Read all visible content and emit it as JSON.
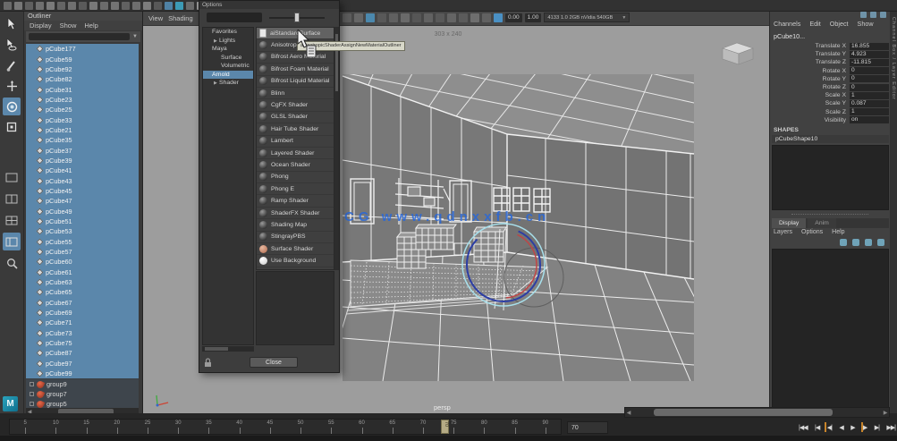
{
  "shelf": {
    "icons": [
      {
        "name": "shelf-icon",
        "color": "#6a6a6a"
      },
      {
        "name": "shelf-icon",
        "color": "#777777"
      },
      {
        "name": "shelf-icon",
        "color": "#5f5f5f"
      },
      {
        "name": "shelf-icon",
        "color": "#6f6f6f"
      },
      {
        "name": "shelf-icon",
        "color": "#7a7a7a"
      },
      {
        "name": "shelf-icon",
        "color": "#646464"
      },
      {
        "name": "shelf-icon",
        "color": "#707070"
      },
      {
        "name": "shelf-icon",
        "color": "#5a5a5a"
      },
      {
        "name": "shelf-icon",
        "color": "#787878"
      },
      {
        "name": "shelf-icon",
        "color": "#6b6b6b"
      },
      {
        "name": "shelf-icon",
        "color": "#737373"
      },
      {
        "name": "shelf-icon",
        "color": "#616161"
      },
      {
        "name": "shelf-icon",
        "color": "#6e6e6e"
      },
      {
        "name": "shelf-icon",
        "color": "#7c7c7c"
      },
      {
        "name": "shelf-icon",
        "color": "#585858"
      },
      {
        "name": "shelf-icon",
        "color": "#4f81a4"
      },
      {
        "name": "shelf-icon",
        "color": "#3c9ab5"
      },
      {
        "name": "shelf-icon",
        "color": "#6a6a6a"
      },
      {
        "name": "shelf-icon",
        "color": "#9a9a9a"
      },
      {
        "name": "shelf-icon",
        "color": "#8d8d8d"
      },
      {
        "name": "shelf-icon",
        "color": "#969696"
      },
      {
        "name": "shelf-icon",
        "color": "#6d6d6d"
      },
      {
        "name": "shelf-icon",
        "color": "#5e5e5e"
      },
      {
        "name": "shelf-icon",
        "color": "#757575"
      },
      {
        "name": "shelf-icon",
        "color": "#686868"
      },
      {
        "name": "shelf-icon",
        "color": "#7b7b7b"
      },
      {
        "name": "shelf-icon",
        "color": "#5c5c5c"
      },
      {
        "name": "shelf-icon",
        "color": "#4a7ea6"
      },
      {
        "name": "shelf-icon",
        "color": "#717171"
      },
      {
        "name": "shelf-icon",
        "color": "#666666"
      }
    ]
  },
  "toolbox": {
    "tools": [
      {
        "name": "select-tool",
        "glyph": "arrow",
        "active": false
      },
      {
        "name": "lasso-tool",
        "glyph": "lasso",
        "active": false
      },
      {
        "name": "paint-select-tool",
        "glyph": "brush",
        "active": false
      },
      {
        "name": "move-tool",
        "glyph": "move",
        "active": false
      },
      {
        "name": "rotate-tool",
        "glyph": "rotate",
        "active": true
      },
      {
        "name": "scale-tool",
        "glyph": "scale",
        "active": false
      }
    ],
    "layouts": [
      {
        "name": "single-pane-layout",
        "glyph": "pane1",
        "active": false
      },
      {
        "name": "two-pane-layout",
        "glyph": "pane2",
        "active": false
      },
      {
        "name": "four-pane-layout",
        "glyph": "pane4",
        "active": false
      },
      {
        "name": "persp-outliner-layout",
        "glyph": "paneo",
        "active": true
      },
      {
        "name": "zoom-layout",
        "glyph": "zoom",
        "active": false
      }
    ],
    "logo": "M"
  },
  "outliner": {
    "title": "Outliner",
    "menus": [
      {
        "label": "Display"
      },
      {
        "label": "Show"
      },
      {
        "label": "Help"
      }
    ],
    "items": [
      {
        "name": "pCube177",
        "selected": true
      },
      {
        "name": "pCube59",
        "selected": true
      },
      {
        "name": "pCube92",
        "selected": true
      },
      {
        "name": "pCube82",
        "selected": true
      },
      {
        "name": "pCube31",
        "selected": true
      },
      {
        "name": "pCube23",
        "selected": true
      },
      {
        "name": "pCube25",
        "selected": true
      },
      {
        "name": "pCube33",
        "selected": true
      },
      {
        "name": "pCube21",
        "selected": true
      },
      {
        "name": "pCube35",
        "selected": true
      },
      {
        "name": "pCube37",
        "selected": true
      },
      {
        "name": "pCube39",
        "selected": true
      },
      {
        "name": "pCube41",
        "selected": true
      },
      {
        "name": "pCube43",
        "selected": true
      },
      {
        "name": "pCube45",
        "selected": true
      },
      {
        "name": "pCube47",
        "selected": true
      },
      {
        "name": "pCube49",
        "selected": true
      },
      {
        "name": "pCube51",
        "selected": true
      },
      {
        "name": "pCube53",
        "selected": true
      },
      {
        "name": "pCube55",
        "selected": true
      },
      {
        "name": "pCube57",
        "selected": true
      },
      {
        "name": "pCube60",
        "selected": true
      },
      {
        "name": "pCube61",
        "selected": true
      },
      {
        "name": "pCube63",
        "selected": true
      },
      {
        "name": "pCube65",
        "selected": true
      },
      {
        "name": "pCube67",
        "selected": true
      },
      {
        "name": "pCube69",
        "selected": true
      },
      {
        "name": "pCube71",
        "selected": true
      },
      {
        "name": "pCube73",
        "selected": true
      },
      {
        "name": "pCube75",
        "selected": true
      },
      {
        "name": "pCube87",
        "selected": true
      },
      {
        "name": "pCube97",
        "selected": true
      },
      {
        "name": "pCube99",
        "selected": true
      }
    ],
    "groups": [
      {
        "name": "group9"
      },
      {
        "name": "group7"
      },
      {
        "name": "group5"
      }
    ]
  },
  "panelbar": {
    "menus": [
      {
        "label": "View"
      },
      {
        "label": "Shading"
      }
    ],
    "exposure": "0.00",
    "gamma": "1.00",
    "renderer_label": "4133 1.0 2GB nVidia 540GB",
    "icons": [
      {
        "name": "select-camera-icon",
        "color": "#5d5d5d"
      },
      {
        "name": "lock-camera-icon",
        "color": "#666666"
      },
      {
        "name": "camera-attributes-icon",
        "color": "#4b88ad"
      },
      {
        "name": "bookmark-icon",
        "color": "#585858"
      },
      {
        "name": "image-plane-icon",
        "color": "#606060"
      },
      {
        "name": "view-grid-icon",
        "color": "#6a6a6a"
      },
      {
        "name": "film-gate-icon",
        "color": "#565656"
      },
      {
        "name": "resolution-gate-icon",
        "color": "#626262"
      },
      {
        "name": "gate-mask-icon",
        "color": "#595959"
      },
      {
        "name": "field-chart-icon",
        "color": "#646464"
      },
      {
        "name": "safe-action-icon",
        "color": "#5b5b5b"
      },
      {
        "name": "exposure-icon",
        "color": "#6e6e6e"
      },
      {
        "name": "gamma-icon",
        "color": "#616161"
      },
      {
        "name": "vr-icon",
        "color": "#4a90c4"
      }
    ]
  },
  "viewport": {
    "resolution_label": "303 x 240",
    "camera_label": "persp",
    "watermark": "技艺CG  www.qdnxxfb.cn",
    "watermark_color": "#2a68d8"
  },
  "dialog": {
    "title": "Options",
    "tree": [
      {
        "label": "Favorites",
        "pad": "4px",
        "bullet": true,
        "arrow": "",
        "selected": false
      },
      {
        "label": "Lights",
        "pad": "12px",
        "bullet": false,
        "arrow": "▶",
        "selected": false
      },
      {
        "label": "Maya",
        "pad": "4px",
        "bullet": true,
        "arrow": "",
        "selected": false
      },
      {
        "label": "Surface",
        "pad": "14px",
        "bullet": false,
        "arrow": "",
        "selected": false
      },
      {
        "label": "Volumetric",
        "pad": "14px",
        "bullet": false,
        "arrow": "",
        "selected": false
      },
      {
        "label": "Arnold",
        "pad": "4px",
        "bullet": true,
        "arrow": "",
        "selected": true
      },
      {
        "label": "Shader",
        "pad": "12px",
        "bullet": false,
        "arrow": "▶",
        "selected": false
      }
    ],
    "materials": [
      {
        "label": "aiStandardSurface",
        "isfile": true,
        "selected": true
      },
      {
        "label": "Anisotropic"
      },
      {
        "label": "Bifrost Aero Material"
      },
      {
        "label": "Bifrost Foam Material"
      },
      {
        "label": "Bifrost Liquid Material"
      },
      {
        "label": "Blinn"
      },
      {
        "label": "CgFX Shader"
      },
      {
        "label": "GLSL Shader"
      },
      {
        "label": "Hair Tube Shader"
      },
      {
        "label": "Lambert"
      },
      {
        "label": "Layered Shader"
      },
      {
        "label": "Ocean Shader"
      },
      {
        "label": "Phong"
      },
      {
        "label": "Phong E"
      },
      {
        "label": "Ramp Shader"
      },
      {
        "label": "ShaderFX Shader"
      },
      {
        "label": "Shading Map"
      },
      {
        "label": "StingrayPBS"
      },
      {
        "label": "Surface Shader",
        "swatch": "radial-gradient(circle at 35% 30%, #e8b9a0, #b06a4e)"
      },
      {
        "label": "Use Background",
        "swatch": "radial-gradient(circle at 35% 30%, #ffffff, #c9c9c9)"
      }
    ],
    "tooltip": "anisotropicShaderAssignNewMaterialOutliner",
    "close_label": "Close"
  },
  "channel_box": {
    "menus": [
      {
        "label": "Channels"
      },
      {
        "label": "Edit"
      },
      {
        "label": "Object"
      },
      {
        "label": "Show"
      }
    ],
    "node_name": "pCube10...",
    "attributes": [
      {
        "label": "Translate X",
        "value": "16.855"
      },
      {
        "label": "Translate Y",
        "value": "4.923"
      },
      {
        "label": "Translate Z",
        "value": "-11.815"
      },
      {
        "label": "Rotate X",
        "value": "0"
      },
      {
        "label": "Rotate Y",
        "value": "0"
      },
      {
        "label": "Rotate Z",
        "value": "0"
      },
      {
        "label": "Scale X",
        "value": "1"
      },
      {
        "label": "Scale Y",
        "value": "0.087"
      },
      {
        "label": "Scale Z",
        "value": "1"
      },
      {
        "label": "Visibility",
        "value": "on"
      }
    ],
    "shapes_label": "SHAPES",
    "shape_name": "pCubeShape10",
    "sidebar_tab": "Channel Box / Layer Editor"
  },
  "layer_editor": {
    "tabs": [
      {
        "label": "Display",
        "active": true
      },
      {
        "label": "Anim",
        "active": false
      }
    ],
    "menus": [
      {
        "label": "Layers"
      },
      {
        "label": "Options"
      },
      {
        "label": "Help"
      }
    ],
    "icons": [
      {
        "name": "new-empty-layer-icon"
      },
      {
        "name": "new-layer-selected-icon"
      },
      {
        "name": "new-render-layer-icon"
      },
      {
        "name": "layer-options-icon"
      }
    ]
  },
  "timeline": {
    "ticks": [
      {
        "label": "5"
      },
      {
        "label": "10"
      },
      {
        "label": "15"
      },
      {
        "label": "20"
      },
      {
        "label": "25"
      },
      {
        "label": "30"
      },
      {
        "label": "35"
      },
      {
        "label": "40"
      },
      {
        "label": "45"
      },
      {
        "label": "50"
      },
      {
        "label": "55"
      },
      {
        "label": "60"
      },
      {
        "label": "65"
      },
      {
        "label": "70"
      },
      {
        "label": "75"
      },
      {
        "label": "80"
      },
      {
        "label": "85"
      },
      {
        "label": "90"
      }
    ],
    "current_frame": "70",
    "current_time_field": "70",
    "playback": [
      {
        "glyph": "|◀◀",
        "name": "go-to-start-button"
      },
      {
        "glyph": "|◀",
        "name": "step-back-frame-button"
      },
      {
        "glyph": "◀|",
        "name": "step-back-key-button"
      },
      {
        "glyph": "◀",
        "name": "play-backwards-button"
      },
      {
        "glyph": "▶",
        "name": "play-forwards-button"
      },
      {
        "glyph": "|▶",
        "name": "step-forward-key-button"
      },
      {
        "glyph": "▶|",
        "name": "step-forward-frame-button"
      },
      {
        "glyph": "▶▶|",
        "name": "go-to-end-button"
      }
    ]
  }
}
